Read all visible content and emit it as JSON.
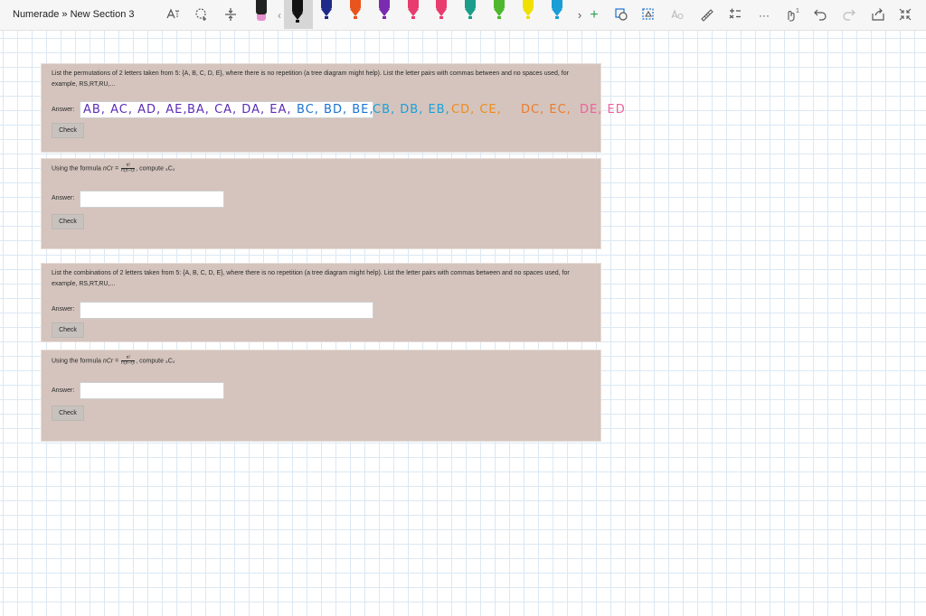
{
  "window": {
    "breadcrumb": "Numerade » New Section 3"
  },
  "pens": [
    {
      "color": "#111111"
    },
    {
      "color": "#e58fcf"
    },
    {
      "color": "#111111"
    },
    {
      "color": "#1f2a8a"
    },
    {
      "color": "#e8541c"
    },
    {
      "color": "#7a2bb0"
    },
    {
      "color": "#e83c6e"
    },
    {
      "color": "#e83c6e"
    },
    {
      "color": "#1a9e8a"
    },
    {
      "color": "#4db82d"
    },
    {
      "color": "#f0e000"
    },
    {
      "color": "#1a9ed6"
    }
  ],
  "toolbar": {
    "icons": [
      "lasso-text-icon",
      "lasso-select-icon",
      "add-space-icon",
      "ruler-icon",
      "eraser-icon"
    ],
    "add_label": "+",
    "more_label": "···",
    "badge_label": "1"
  },
  "cards": [
    {
      "question": "List the permutations of 2 letters taken from 5: {A, B, C, D, E}, where there is no repetition (a tree diagram might help). List the letter pairs with commas between and no spaces used, for example, RS,RT,RU,...",
      "answer_label": "Answer:",
      "check_label": "Check"
    },
    {
      "question_pre": "Using the formula ",
      "question_formula": "nCr =",
      "frac_num": "n!",
      "frac_den": "r!(n−r)!",
      "question_post": ", compute ₅C₂",
      "answer_label": "Answer:",
      "check_label": "Check"
    },
    {
      "question": "List the combinations of 2 letters taken from 5: {A, B, C, D, E}, where there is no repetition (a tree diagram might help). List the letter pairs with commas between and no spaces used, for example, RS,RT,RU,...",
      "answer_label": "Answer:",
      "check_label": "Check"
    },
    {
      "question_pre": "Using the formula ",
      "question_formula": "nCr =",
      "frac_num": "n!",
      "frac_den": "r!(n−r)!",
      "question_post": ", compute ₅C₂",
      "answer_label": "Answer:",
      "check_label": "Check"
    }
  ],
  "handwriting": [
    {
      "text": "AB, AC, AD, AE,",
      "color": "#5b2bb5"
    },
    {
      "text": "BA, CA, DA, EA,",
      "color": "#5b2bb5"
    },
    {
      "text": "BC, BD, BE,",
      "color": "#1a73d0"
    },
    {
      "text": "CB, DB, EB,",
      "color": "#1aa0d8"
    },
    {
      "text": "CD, CE,",
      "color": "#f08a1c"
    },
    {
      "text": "DC, EC,",
      "color": "#f07a28"
    },
    {
      "text": "DE, ED",
      "color": "#f0609a"
    }
  ]
}
